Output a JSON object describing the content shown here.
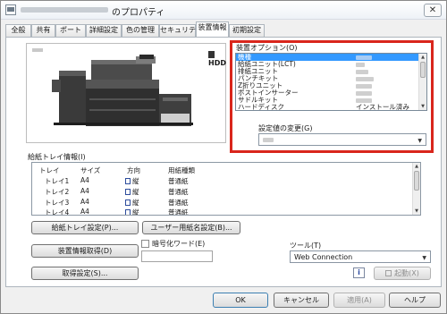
{
  "window": {
    "title_suffix": "のプロパティ",
    "close_glyph": "✕"
  },
  "tabs": [
    {
      "label": "全般"
    },
    {
      "label": "共有"
    },
    {
      "label": "ポート"
    },
    {
      "label": "詳細設定"
    },
    {
      "label": "色の管理"
    },
    {
      "label": "セキュリティ"
    },
    {
      "label": "装置情報"
    },
    {
      "label": "初期設定"
    }
  ],
  "active_tab": "装置情報",
  "preview": {
    "hdd_badge": "HDD"
  },
  "options": {
    "title": "装置オプション(O)",
    "items": [
      {
        "label": "機種",
        "value": ""
      },
      {
        "label": "給紙ユニット(LCT)",
        "value": ""
      },
      {
        "label": "排紙ユニット",
        "value": ""
      },
      {
        "label": "パンチキット",
        "value": ""
      },
      {
        "label": "Z折りユニット",
        "value": ""
      },
      {
        "label": "ポストインサーター",
        "value": ""
      },
      {
        "label": "サドルキット",
        "value": ""
      },
      {
        "label": "ハードディスク",
        "value": "インストール済み"
      }
    ],
    "selected_index": 0,
    "change_label": "設定値の変更(G)",
    "change_value": ""
  },
  "tray_info": {
    "title": "給紙トレイ情報(I)",
    "columns": [
      "トレイ",
      "サイズ",
      "方向",
      "用紙種類"
    ],
    "rows": [
      {
        "tray": "トレイ1",
        "size": "A4",
        "direction": "縦",
        "paper": "普通紙"
      },
      {
        "tray": "トレイ2",
        "size": "A4",
        "direction": "縦",
        "paper": "普通紙"
      },
      {
        "tray": "トレイ3",
        "size": "A4",
        "direction": "縦",
        "paper": "普通紙"
      },
      {
        "tray": "トレイ4",
        "size": "A4",
        "direction": "縦",
        "paper": "普通紙"
      }
    ]
  },
  "buttons": {
    "tray_settings": "給紙トレイ設定(P)...",
    "user_paper": "ユーザー用紙名設定(B)...",
    "get_device_info": "装置情報取得(D)",
    "acquire_settings": "取得設定(S)...",
    "launch": "起動(X)",
    "ok": "OK",
    "cancel": "キャンセル",
    "apply": "適用(A)",
    "help": "ヘルプ"
  },
  "encryption": {
    "label": "暗号化ワード(E)",
    "checked": false,
    "value": ""
  },
  "tool": {
    "label": "ツール(T)",
    "selected": "Web Connection"
  },
  "icons": {
    "info": "i",
    "doc": "document-icon"
  },
  "colors": {
    "highlight": "#d9261c",
    "selection": "#3399ff"
  }
}
